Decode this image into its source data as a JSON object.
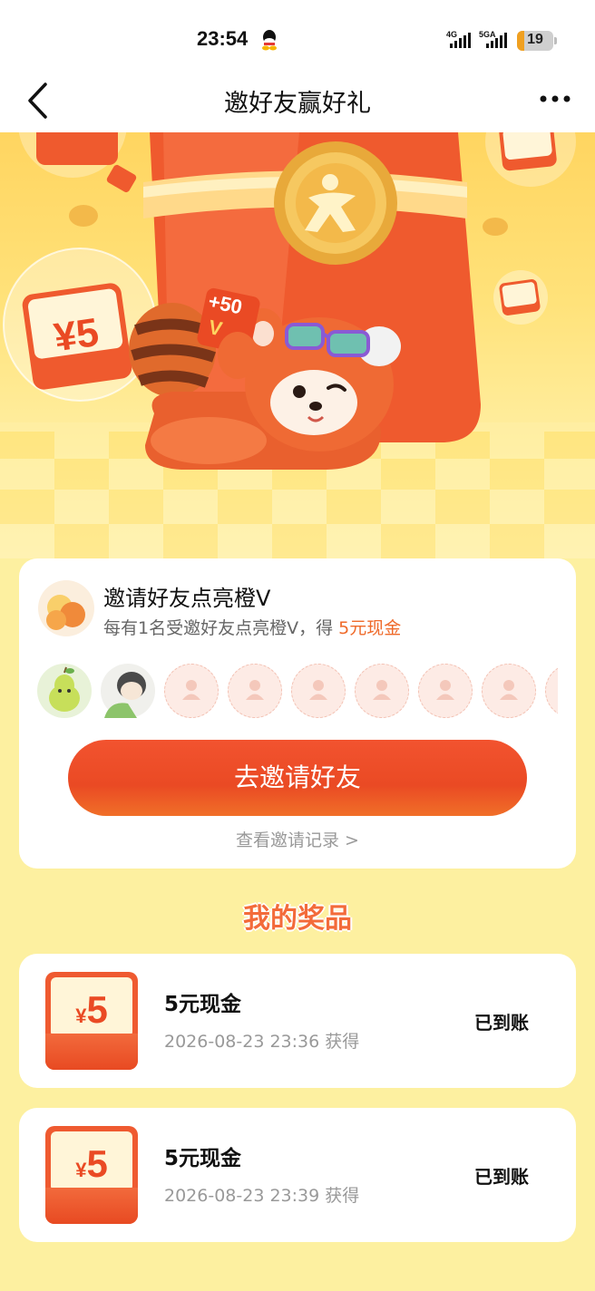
{
  "status_bar": {
    "time": "23:54",
    "network_1": "4G",
    "network_2": "5GA",
    "battery_level": "19"
  },
  "nav": {
    "title": "邀好友赢好礼",
    "back_icon": "chevron-left-icon",
    "more_icon": "more-horizontal-icon"
  },
  "hero": {
    "tag_plus": "+50",
    "tag_v": "V",
    "bubble_amount": "¥5",
    "colors": {
      "accent": "#ea4a24",
      "background": "#ffd560"
    }
  },
  "invite": {
    "title": "邀请好友点亮橙V",
    "desc_prefix": "每有1名受邀好友点亮橙V，得 ",
    "desc_highlight": "5元现金",
    "button_label": "去邀请好友",
    "record_link": "查看邀请记录 >",
    "filled_avatars": 2,
    "empty_slots": 7
  },
  "prizes": {
    "section_title": "我的奖品",
    "items": [
      {
        "yen": "¥",
        "amount": "5",
        "name": "5元现金",
        "time": "2026-08-23 23:36 获得",
        "status": "已到账"
      },
      {
        "yen": "¥",
        "amount": "5",
        "name": "5元现金",
        "time": "2026-08-23 23:39 获得",
        "status": "已到账"
      }
    ]
  }
}
